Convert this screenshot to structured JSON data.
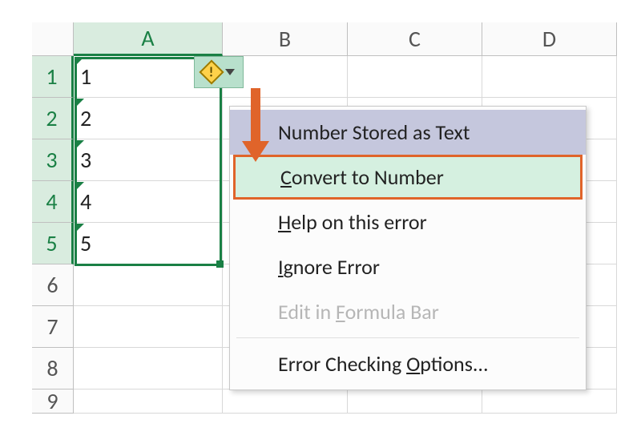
{
  "columns": {
    "A": "A",
    "B": "B",
    "C": "C",
    "D": "D"
  },
  "rows": [
    "1",
    "2",
    "3",
    "4",
    "5",
    "6",
    "7",
    "8",
    "9"
  ],
  "data_col_a": [
    "1",
    "2",
    "3",
    "4",
    "5"
  ],
  "smart_tag": {
    "icon_label": "!"
  },
  "menu": {
    "header": "Number Stored as Text",
    "convert": "Convert to Number",
    "convert_accel": "C",
    "help": "Help on this error",
    "help_accel": "H",
    "ignore": "Ignore Error",
    "ignore_accel": "I",
    "edit": "Edit in Formula Bar",
    "edit_accel": "F",
    "options": "Error Checking Options...",
    "options_accel": "O"
  }
}
